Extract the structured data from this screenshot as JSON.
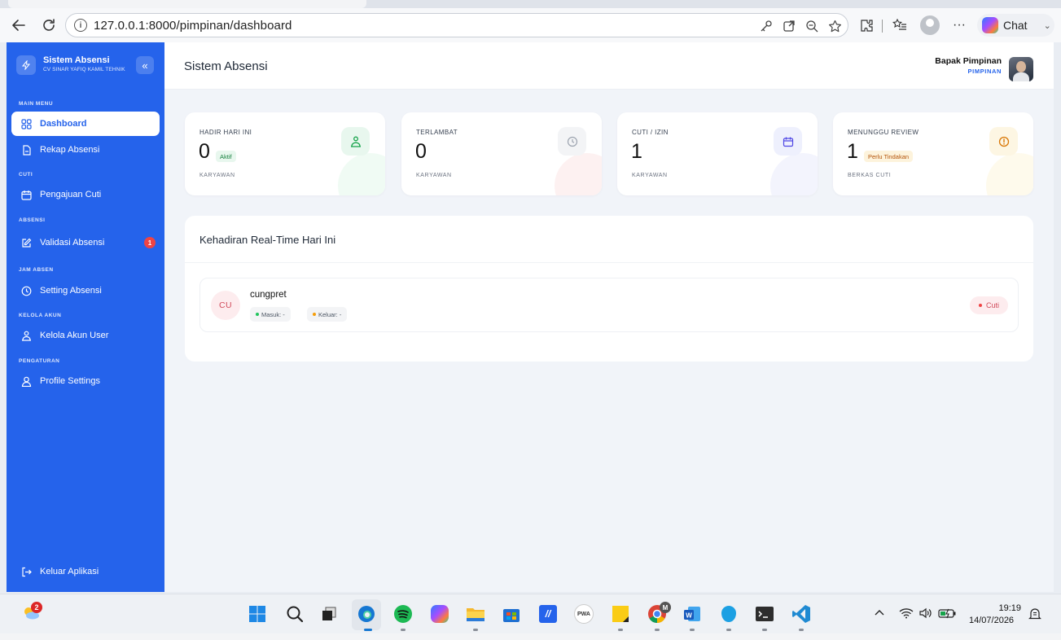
{
  "browser": {
    "url": "127.0.0.1:8000/pimpinan/dashboard",
    "chat_label": "Chat"
  },
  "sidebar": {
    "app_title": "Sistem Absensi",
    "company": "CV SINAR YAFIQ KAMIL TEHNIK",
    "sections": {
      "main": "MAIN MENU",
      "cuti": "CUTI",
      "absensi": "ABSENSI",
      "jam_absen": "JAM ABSEN",
      "kelola_akun": "KELOLA AKUN",
      "pengaturan": "PENGATURAN"
    },
    "items": {
      "dashboard": "Dashboard",
      "rekap": "Rekap Absensi",
      "pengajuan_cuti": "Pengajuan Cuti",
      "validasi": "Validasi Absensi",
      "validasi_badge": "1",
      "setting_absensi": "Setting Absensi",
      "kelola_akun_user": "Kelola Akun User",
      "profile_settings": "Profile Settings",
      "logout": "Keluar Aplikasi"
    }
  },
  "header": {
    "title": "Sistem Absensi",
    "user_name": "Bapak Pimpinan",
    "user_role": "PIMPINAN"
  },
  "stats": [
    {
      "label": "HADIR HARI INI",
      "value": "0",
      "pill": "Aktif",
      "sub": "KARYAWAN",
      "icon": "user-check-icon",
      "color": "#16a34a"
    },
    {
      "label": "TERLAMBAT",
      "value": "0",
      "pill": "",
      "sub": "KARYAWAN",
      "icon": "clock-icon",
      "color": "#9ca3af"
    },
    {
      "label": "CUTI / IZIN",
      "value": "1",
      "pill": "",
      "sub": "KARYAWAN",
      "icon": "calendar-icon",
      "color": "#4f46e5"
    },
    {
      "label": "MENUNGGU REVIEW",
      "value": "1",
      "pill": "Perlu Tindakan",
      "sub": "BERKAS CUTI",
      "icon": "alert-circle-icon",
      "color": "#d97706"
    }
  ],
  "realtime": {
    "title": "Kehadiran Real-Time Hari Ini",
    "employees": [
      {
        "initials": "CU",
        "name": "cungpret",
        "masuk": "Masuk: -",
        "keluar": "Keluar: -",
        "status": "Cuti"
      }
    ]
  },
  "taskbar": {
    "notification_count": "2",
    "chrome_badge": "M",
    "pwa_label": "PWA",
    "time": "19:19",
    "date": "14/07/2026"
  }
}
